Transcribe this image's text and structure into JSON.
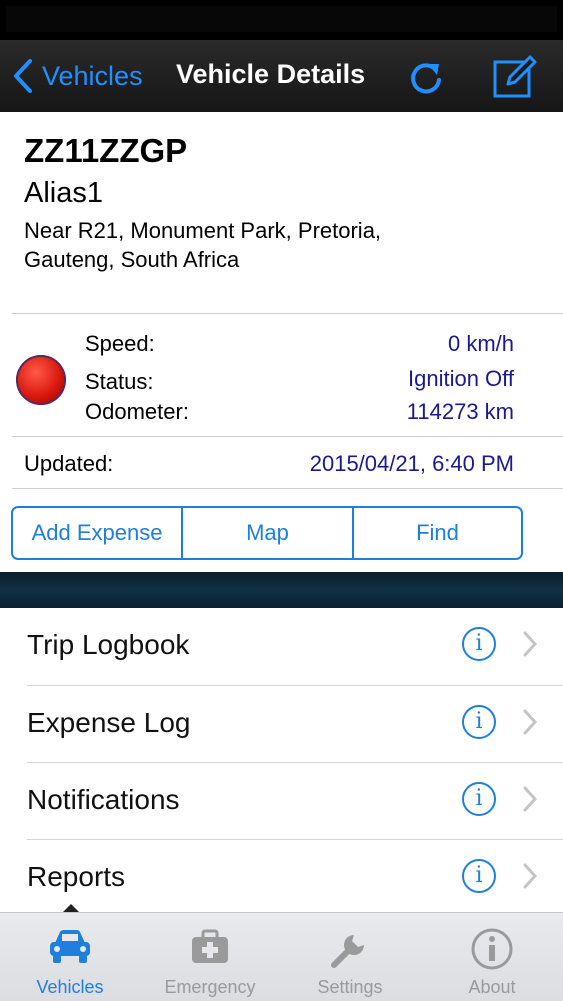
{
  "nav": {
    "back_label": "Vehicles",
    "title": "Vehicle Details"
  },
  "vehicle": {
    "plate": "ZZ11ZZGP",
    "alias": "Alias1",
    "address": "Near R21, Monument Park, Pretoria, Gauteng, South Africa",
    "status_color": "#e0271b"
  },
  "details": {
    "speed_label": "Speed:",
    "speed_value": "0 km/h",
    "status_label": "Status:",
    "status_value": "Ignition Off",
    "odometer_label": "Odometer:",
    "odometer_value": "114273 km",
    "updated_label": "Updated:",
    "updated_value": "2015/04/21, 6:40 PM"
  },
  "actions": [
    "Add Expense",
    "Map",
    "Find"
  ],
  "menu": [
    {
      "label": "Trip Logbook",
      "icon": "info-icon"
    },
    {
      "label": "Expense Log",
      "icon": "info-icon"
    },
    {
      "label": "Notifications",
      "icon": "info-icon"
    },
    {
      "label": "Reports",
      "icon": "info-icon"
    }
  ],
  "tabs": [
    {
      "label": "Vehicles",
      "icon": "car-icon",
      "active": true
    },
    {
      "label": "Emergency",
      "icon": "first-aid-icon",
      "active": false
    },
    {
      "label": "Settings",
      "icon": "wrench-icon",
      "active": false
    },
    {
      "label": "About",
      "icon": "info-icon",
      "active": false
    }
  ],
  "colors": {
    "accent": "#1e7fdc",
    "value_text": "#1a1a8c"
  }
}
